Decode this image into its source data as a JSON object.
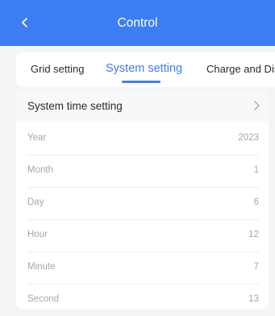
{
  "header": {
    "title": "Control"
  },
  "tabs": [
    {
      "label": "Grid setting",
      "active": false
    },
    {
      "label": "System setting",
      "active": true
    },
    {
      "label": "Charge and Dis",
      "active": false
    }
  ],
  "section": {
    "title": "System time setting"
  },
  "fields": [
    {
      "label": "Year",
      "value": "2023"
    },
    {
      "label": "Month",
      "value": "1"
    },
    {
      "label": "Day",
      "value": "6"
    },
    {
      "label": "Hour",
      "value": "12"
    },
    {
      "label": "Minute",
      "value": "7"
    },
    {
      "label": "Second",
      "value": "13"
    }
  ],
  "colors": {
    "accent": "#3d7ef5",
    "background": "#f4f5f7",
    "muted_text": "#a6a6a6"
  },
  "icons": {
    "back": "chevron-left-icon",
    "section_arrow": "chevron-right-icon"
  }
}
